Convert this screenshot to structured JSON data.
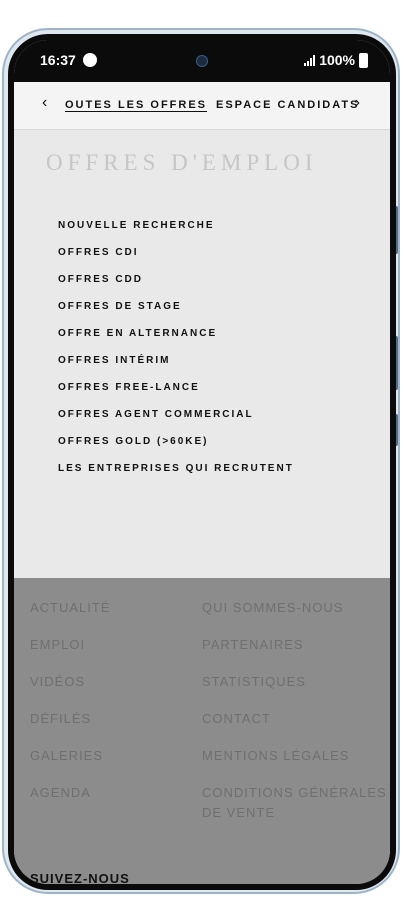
{
  "status_bar": {
    "time": "16:37",
    "battery": "100%"
  },
  "nav": {
    "active_link": "OUTES LES OFFRES",
    "next_link": "ESPACE CANDIDATS",
    "prev_arrow": "‹",
    "next_arrow": "›"
  },
  "page": {
    "title": "OFFRES D'EMPLOI"
  },
  "job_menu": [
    "NOUVELLE RECHERCHE",
    "OFFRES CDI",
    "OFFRES CDD",
    "OFFRES DE STAGE",
    "OFFRE EN ALTERNANCE",
    "OFFRES INTÉRIM",
    "OFFRES FREE-LANCE",
    "OFFRES AGENT COMMERCIAL",
    "OFFRES GOLD (>60KE)",
    "LES ENTREPRISES QUI RECRUTENT"
  ],
  "footer": {
    "left_links": [
      "ACTUALITÉ",
      "EMPLOI",
      "VIDÉOS",
      "DÉFILÉS",
      "GALERIES",
      "AGENDA"
    ],
    "right_links": [
      "QUI SOMMES-NOUS",
      "PARTENAIRES",
      "STATISTIQUES",
      "CONTACT",
      "MENTIONS LÉGALES",
      "CONDITIONS GÉNÉRALES DE VENTE"
    ],
    "follow_title": "SUIVEZ-NOUS"
  },
  "icons": {
    "status_app": "spotify-icon",
    "signal": "signal-bars-icon",
    "battery": "battery-icon"
  }
}
